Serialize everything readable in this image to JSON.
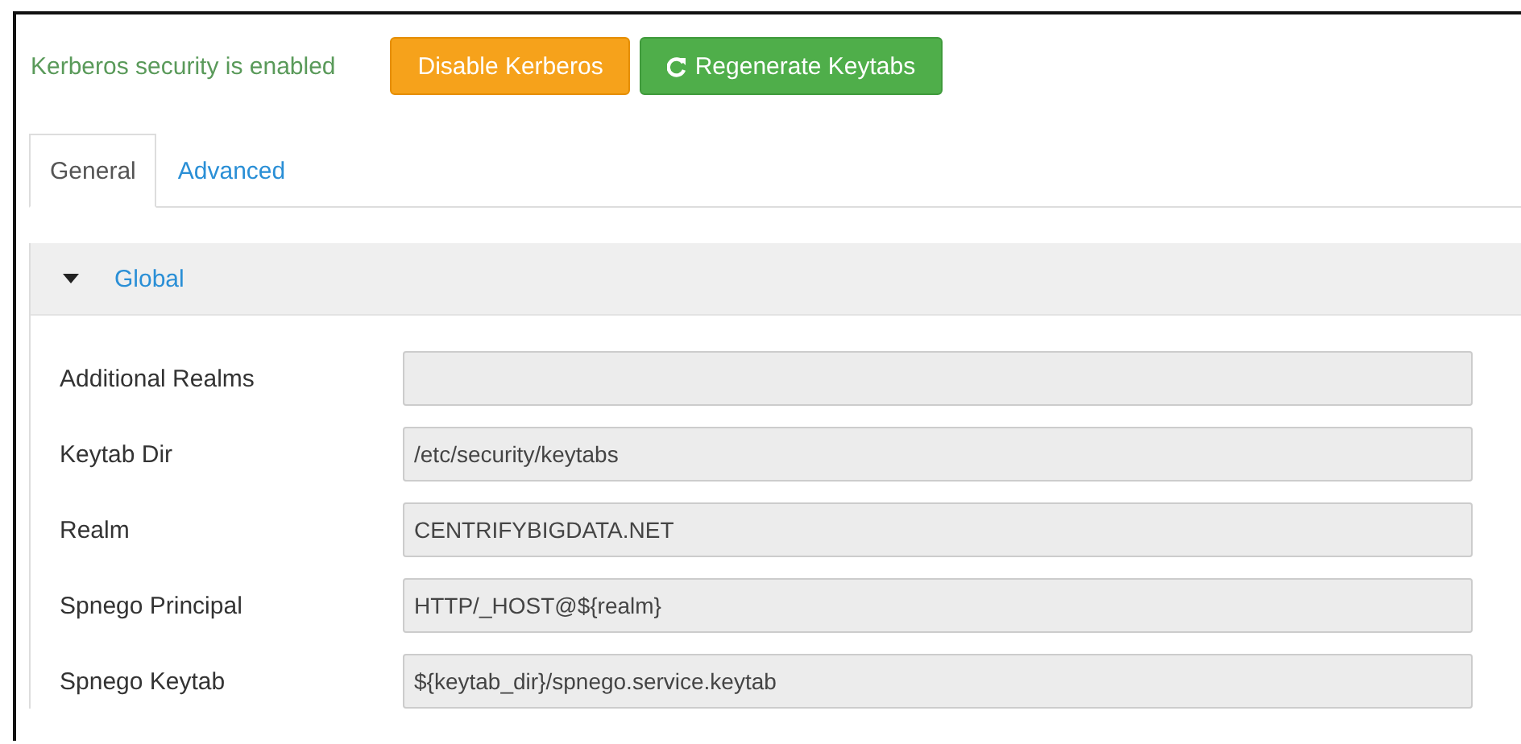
{
  "status": {
    "text": "Kerberos security is enabled"
  },
  "buttons": [
    {
      "label": "Disable Kerberos",
      "kind": "warning"
    },
    {
      "label": "Regenerate Keytabs",
      "kind": "success"
    }
  ],
  "tabs": [
    {
      "label": "General",
      "selected": true
    },
    {
      "label": "Advanced",
      "selected": false
    }
  ],
  "section": {
    "title": "Global",
    "expanded": true,
    "fields": [
      {
        "label": "Additional Realms",
        "disabled": true
      },
      {
        "label": "Keytab Dir",
        "value": "/etc/security/keytabs",
        "disabled": true
      },
      {
        "label": "Realm",
        "value": "CENTRIFYBIGDATA.NET",
        "disabled": true
      },
      {
        "label": "Spnego Principal",
        "value": "HTTP/_HOST@${realm}",
        "disabled": true
      },
      {
        "label": "Spnego Keytab",
        "value": "${keytab_dir}/spnego.service.keytab",
        "disabled": true
      }
    ]
  }
}
